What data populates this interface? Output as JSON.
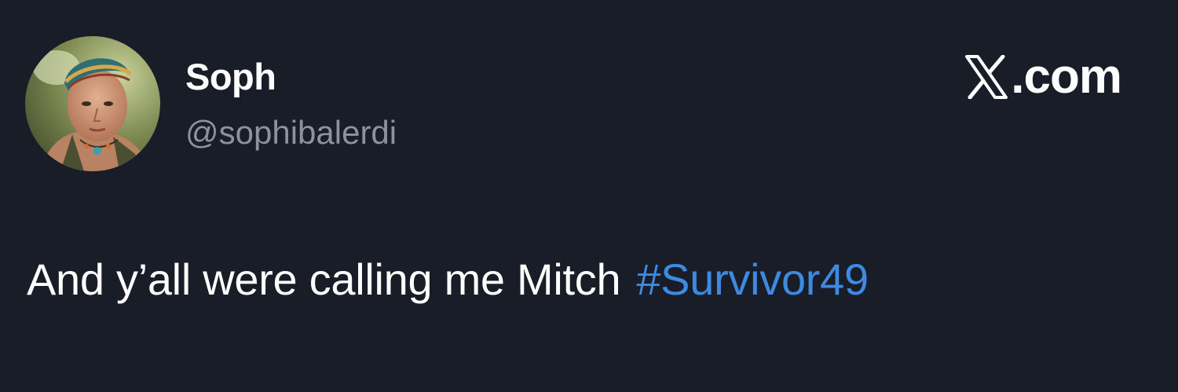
{
  "user": {
    "display_name": "Soph",
    "handle": "@sophibalerdi"
  },
  "brand": {
    "label": ".com",
    "icon": "x-logo-icon"
  },
  "tweet": {
    "text": "And y’all were calling me Mitch",
    "hashtag": "#Survivor49"
  },
  "colors": {
    "background": "#181d27",
    "text": "#ffffff",
    "handle": "#8b93a1",
    "hashtag": "#3d8ae0"
  }
}
